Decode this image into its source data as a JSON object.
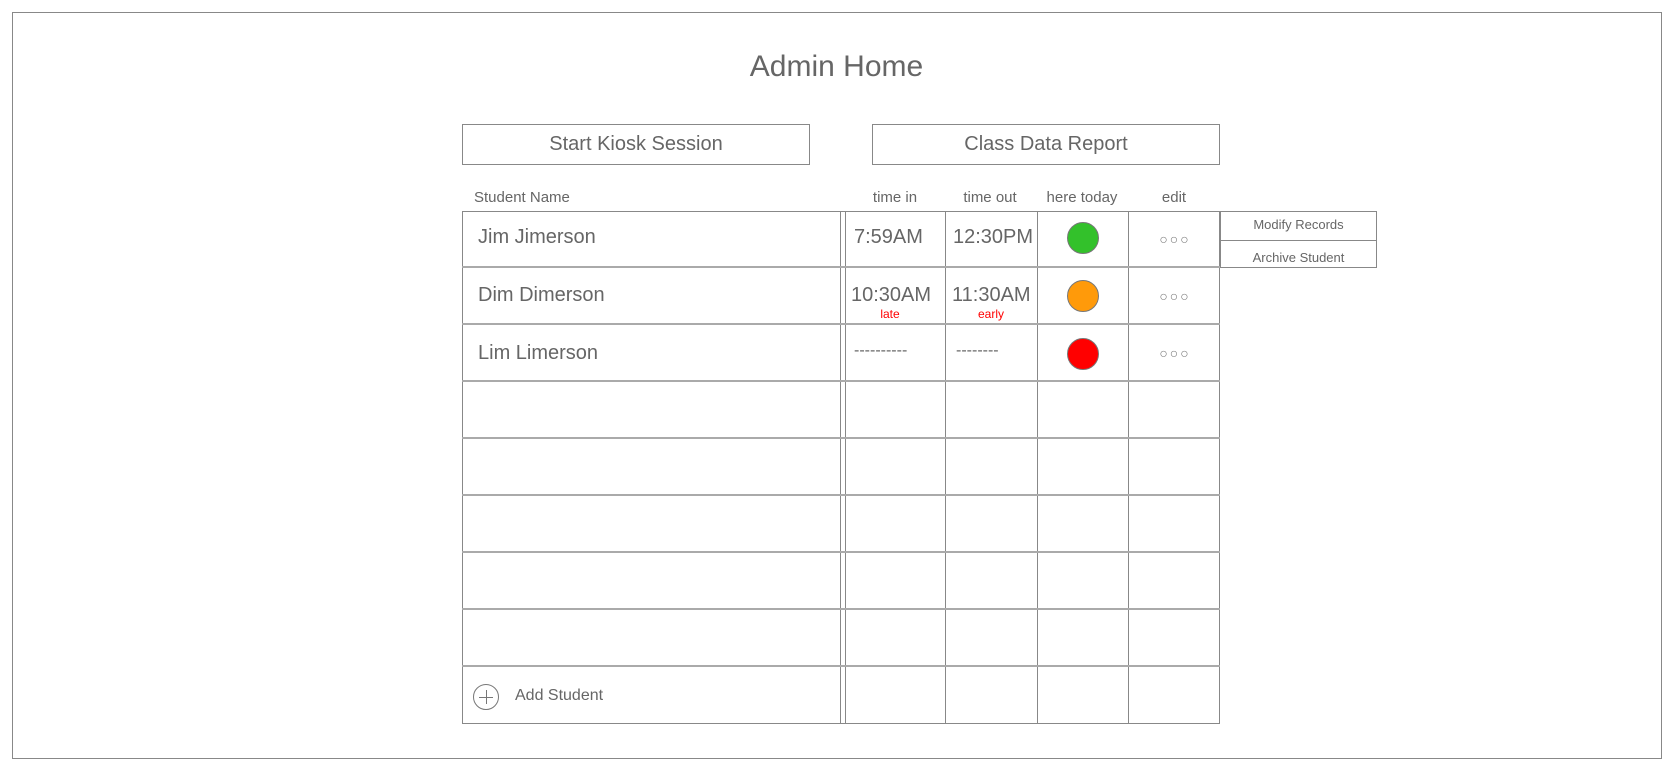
{
  "page": {
    "title": "Admin Home"
  },
  "toolbar": {
    "start_kiosk_label": "Start Kiosk Session",
    "class_report_label": "Class Data Report"
  },
  "table": {
    "headers": {
      "name": "Student Name",
      "time_in": "time in",
      "time_out": "time out",
      "here_today": "here today",
      "edit": "edit"
    },
    "rows": [
      {
        "name": "Jim Jimerson",
        "time_in": "7:59AM",
        "time_in_note": "",
        "time_out": "12:30PM",
        "time_out_note": "",
        "status_color": "#33c12b",
        "edit_label": "○○○"
      },
      {
        "name": "Dim Dimerson",
        "time_in": "10:30AM",
        "time_in_note": "late",
        "time_out": "11:30AM",
        "time_out_note": "early",
        "status_color": "#ff9a0a",
        "edit_label": "○○○"
      },
      {
        "name": "Lim Limerson",
        "time_in": "----------",
        "time_in_note": "",
        "time_out": "--------",
        "time_out_note": "",
        "status_color": "#ff0000",
        "edit_label": "○○○"
      }
    ],
    "add_student_label": "Add Student"
  },
  "edit_menu": {
    "modify_label": "Modify Records",
    "archive_label": "Archive Student"
  },
  "colors": {
    "border": "#888888",
    "text": "#666666",
    "warning_text": "#ff0000"
  }
}
